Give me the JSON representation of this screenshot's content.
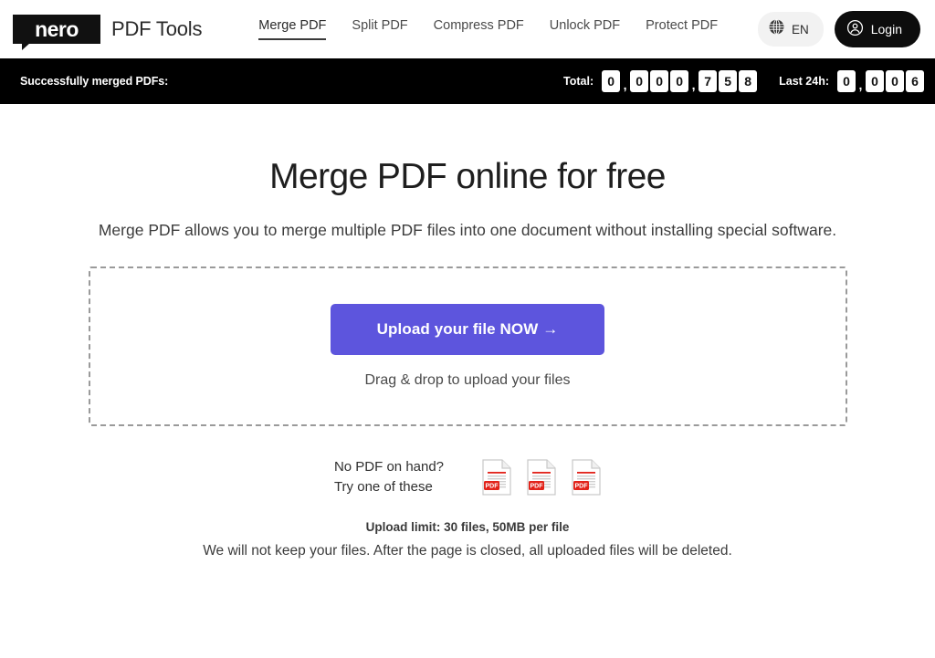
{
  "header": {
    "logo_text": "nero",
    "logo_icon": "nero-speech-bubble-logo",
    "brand_title": "PDF Tools",
    "nav": [
      {
        "label": "Merge PDF",
        "active": true
      },
      {
        "label": "Split PDF",
        "active": false
      },
      {
        "label": "Compress PDF",
        "active": false
      },
      {
        "label": "Unlock PDF",
        "active": false
      },
      {
        "label": "Protect PDF",
        "active": false
      }
    ],
    "language": {
      "icon": "globe-icon",
      "label": "EN"
    },
    "login": {
      "icon": "user-circle-icon",
      "label": "Login"
    }
  },
  "counter_bar": {
    "title": "Successfully merged PDFs:",
    "total": {
      "label": "Total:",
      "value": "0,000,758",
      "digits": [
        "0",
        ",",
        "0",
        "0",
        "0",
        ",",
        "7",
        "5",
        "8"
      ]
    },
    "last24h": {
      "label": "Last 24h:",
      "value": "0,006",
      "digits": [
        "0",
        ",",
        "0",
        "0",
        "6"
      ]
    }
  },
  "main": {
    "title": "Merge PDF online for free",
    "subtitle": "Merge PDF allows you to merge multiple PDF files into one document without installing special software.",
    "upload_button": "Upload your file NOW →",
    "drop_hint": "Drag & drop to upload your files",
    "samples_line1": "No PDF on hand?",
    "samples_line2": "Try one of these",
    "sample_files": [
      "sample-pdf-1",
      "sample-pdf-2",
      "sample-pdf-3"
    ],
    "limit_note": "Upload limit: 30 files, 50MB per file",
    "privacy_note": "We will not keep your files. After the page is closed, all uploaded files will be deleted."
  },
  "colors": {
    "accent_purple": "#5d55dd",
    "counter_bar_bg": "#000000",
    "login_bg": "#0d0d0d",
    "pdf_badge_red": "#e2231a"
  }
}
